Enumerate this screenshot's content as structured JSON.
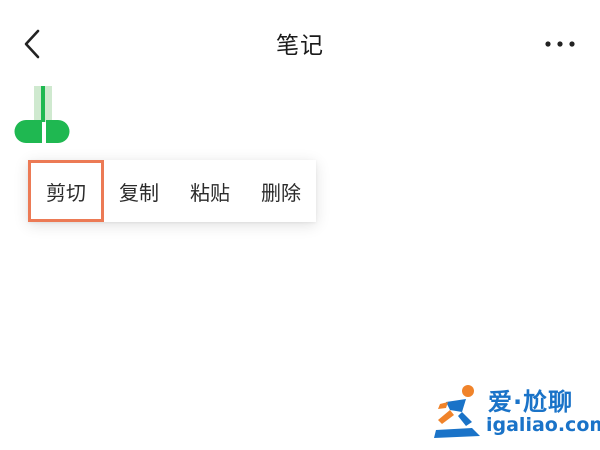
{
  "navbar": {
    "title": "笔记",
    "back_icon": "chevron-left-icon",
    "more_icon": "more-horizontal-icon"
  },
  "context_menu": {
    "items": [
      {
        "label": "剪切",
        "highlighted": true
      },
      {
        "label": "复制"
      },
      {
        "label": "粘贴"
      },
      {
        "label": "删除"
      }
    ],
    "highlight_color": "#ec7a55"
  },
  "selection_handle": {
    "color": "#1fb851"
  },
  "watermark": {
    "text_cn": "爱·尬聊",
    "text_en": "igaliao.com",
    "color": "#1a73c8"
  }
}
